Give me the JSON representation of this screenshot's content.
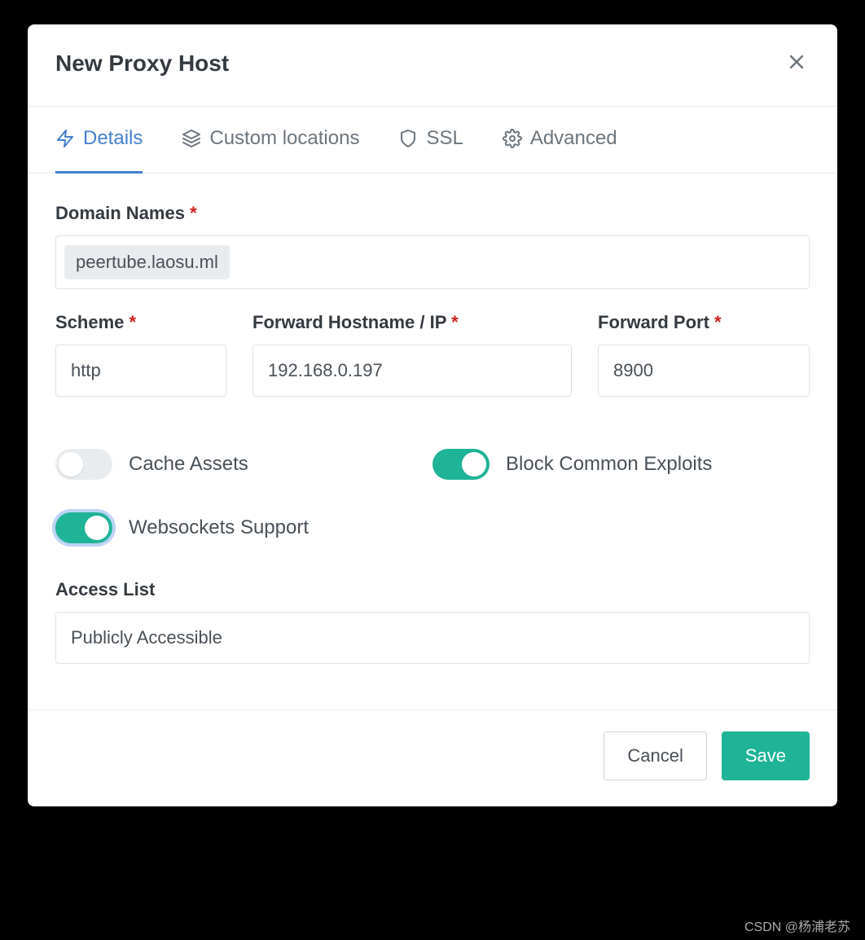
{
  "modal": {
    "title": "New Proxy Host"
  },
  "tabs": {
    "details": "Details",
    "custom_locations": "Custom locations",
    "ssl": "SSL",
    "advanced": "Advanced"
  },
  "form": {
    "domain_names_label": "Domain Names",
    "domain_names_value": "peertube.laosu.ml",
    "scheme_label": "Scheme",
    "scheme_value": "http",
    "forward_hostname_label": "Forward Hostname / IP",
    "forward_hostname_value": "192.168.0.197",
    "forward_port_label": "Forward Port",
    "forward_port_value": "8900",
    "cache_assets_label": "Cache Assets",
    "cache_assets_on": false,
    "block_exploits_label": "Block Common Exploits",
    "block_exploits_on": true,
    "websockets_label": "Websockets Support",
    "websockets_on": true,
    "access_list_label": "Access List",
    "access_list_value": "Publicly Accessible"
  },
  "buttons": {
    "cancel": "Cancel",
    "save": "Save"
  },
  "watermark": "CSDN @杨浦老苏",
  "req_marker": "*"
}
